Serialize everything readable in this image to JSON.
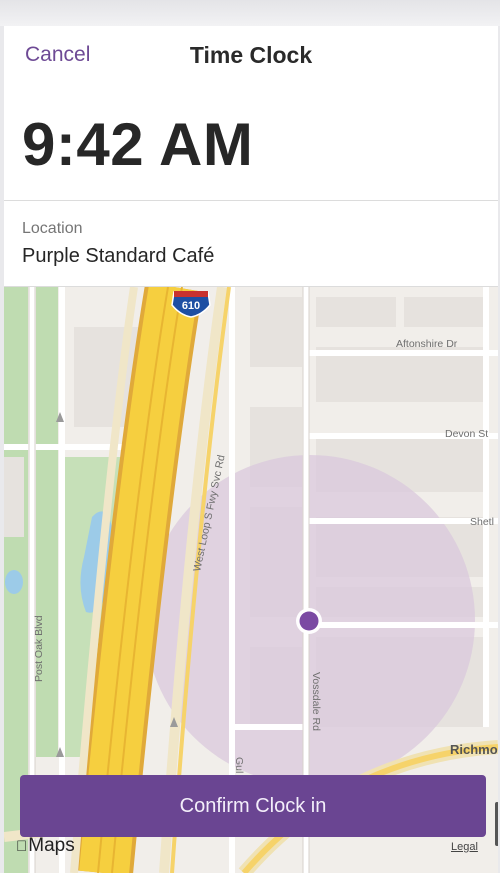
{
  "header": {
    "cancel_label": "Cancel",
    "title": "Time Clock"
  },
  "clock": {
    "time": "9:42 AM"
  },
  "location": {
    "label": "Location",
    "value": "Purple Standard Café"
  },
  "map": {
    "highway_shield": "610",
    "streets": {
      "aftonshire": "Aftonshire Dr",
      "devon": "Devon St",
      "shetland": "Shetl",
      "west_loop": "West Loop S Fwy Svc Rd",
      "post_oak": "Post Oak Blvd",
      "vossdale": "Vossdale Rd",
      "richmond": "Richmo",
      "gulf": "Gul"
    },
    "attribution": "Maps",
    "legal": "Legal"
  },
  "actions": {
    "confirm_label": "Confirm Clock in"
  },
  "colors": {
    "accent": "#6a4592",
    "pin": "#7b4aa3",
    "radius_fill": "#d9c8dc"
  }
}
